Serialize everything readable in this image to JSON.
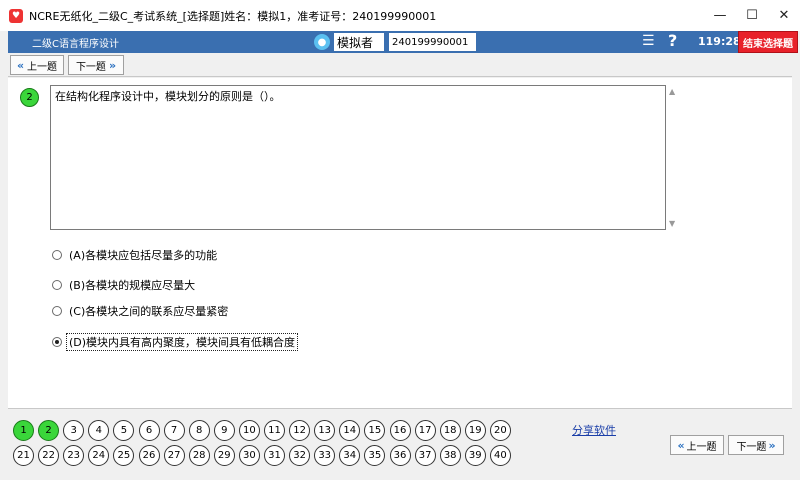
{
  "window": {
    "title": "NCRE无纸化_二级C_考试系统_[选择题]姓名：模拟1，准考证号：240199990001",
    "minimize": "—",
    "maximize": "☐",
    "close": "✕"
  },
  "header": {
    "subject": "二级C语言程序设计",
    "user_name": "模拟者",
    "exam_id": "240199990001",
    "timer": "119:28",
    "end_label": "结束选择题",
    "list_icon": "☰",
    "help_icon": "?"
  },
  "toolbar": {
    "prev_label": "上一题",
    "next_label": "下一题"
  },
  "question": {
    "number": "2",
    "text": "在结构化程序设计中，模块划分的原则是（）。",
    "options": [
      {
        "text": "(A)各模块应包括尽量多的功能",
        "selected": false
      },
      {
        "text": "(B)各模块的规模应尽量大",
        "selected": false
      },
      {
        "text": "(C)各模块之间的联系应尽量紧密",
        "selected": false
      },
      {
        "text": "(D)模块内具有高内聚度，模块间具有低耦合度",
        "selected": true
      }
    ]
  },
  "answer_sheet": {
    "numbers": [
      "1",
      "2",
      "3",
      "4",
      "5",
      "6",
      "7",
      "8",
      "9",
      "10",
      "11",
      "12",
      "13",
      "14",
      "15",
      "16",
      "17",
      "18",
      "19",
      "20",
      "21",
      "22",
      "23",
      "24",
      "25",
      "26",
      "27",
      "28",
      "29",
      "30",
      "31",
      "32",
      "33",
      "34",
      "35",
      "36",
      "37",
      "38",
      "39",
      "40"
    ],
    "answered": [
      "1",
      "2"
    ]
  },
  "bottom_nav": {
    "share_label": "分享软件",
    "prev_label": "上一题",
    "next_label": "下一题"
  }
}
